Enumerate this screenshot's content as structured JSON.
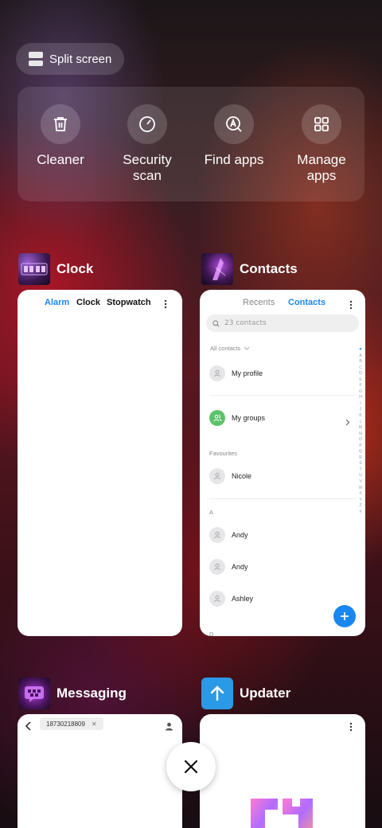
{
  "split_screen": {
    "label": "Split screen"
  },
  "quick_actions": [
    {
      "label": "Cleaner",
      "icon": "trash-icon"
    },
    {
      "label": "Security\nscan",
      "icon": "gauge-icon"
    },
    {
      "label": "Find apps",
      "icon": "find-apps-icon"
    },
    {
      "label": "Manage\napps",
      "icon": "grid-icon"
    }
  ],
  "recents": {
    "clock": {
      "app_name": "Clock",
      "tabs": [
        "Alarm",
        "Clock",
        "Stopwatch"
      ],
      "active_tab": "Alarm"
    },
    "contacts": {
      "app_name": "Contacts",
      "tabs": [
        "Recents",
        "Contacts"
      ],
      "active_tab": "Contacts",
      "search_placeholder": "23 contacts",
      "filter_label": "All contacts",
      "my_profile": "My profile",
      "my_groups": "My groups",
      "favourites_header": "Favourites",
      "favourites": [
        "Nicole"
      ],
      "section_a": "A",
      "contacts_a": [
        "Andy",
        "Andy",
        "Ashley"
      ],
      "section_d": "D",
      "alphabet": [
        "♥",
        "A",
        "B",
        "C",
        "D",
        "E",
        "F",
        "G",
        "H",
        "I",
        "J",
        "K",
        "L",
        "M",
        "N",
        "O",
        "P",
        "Q",
        "R",
        "S",
        "T",
        "U",
        "V",
        "W",
        "X",
        "Y",
        "Z",
        "#"
      ]
    },
    "messaging": {
      "app_name": "Messaging",
      "recipient": "18730218809"
    },
    "updater": {
      "app_name": "Updater"
    }
  },
  "colors": {
    "accent_blue": "#1a86f0",
    "groups_green": "#5cc46a"
  }
}
